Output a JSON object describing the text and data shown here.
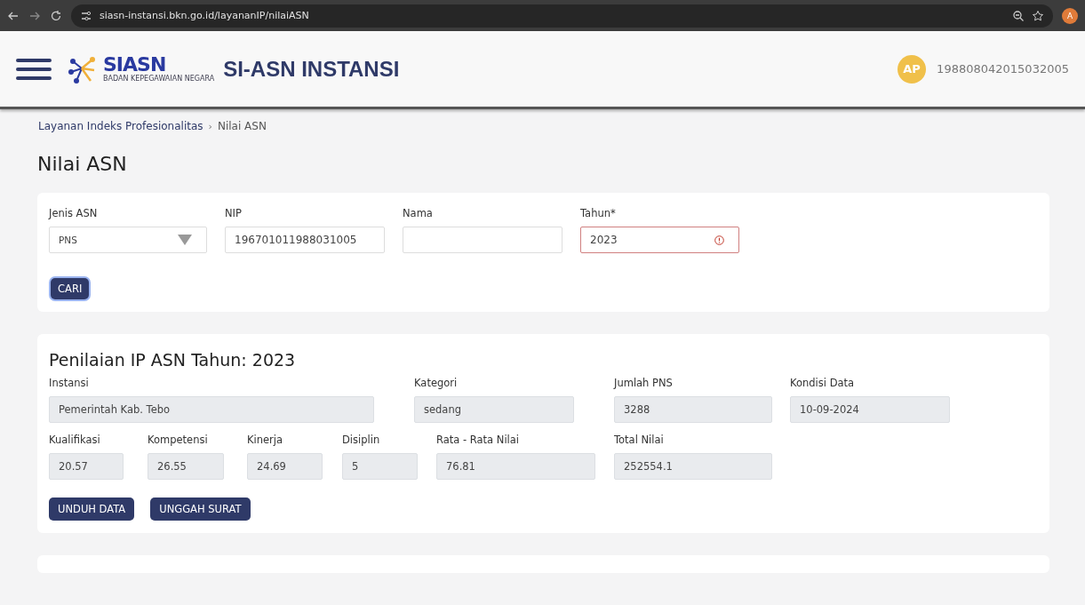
{
  "browser": {
    "url": "siasn-instansi.bkn.go.id/layananIP/nilaiASN",
    "profile_initial": "A"
  },
  "header": {
    "logo_text": "SIASN",
    "logo_subtext": "BADAN KEPEGAWAIAN NEGARA",
    "app_title": "SI-ASN INSTANSI",
    "avatar_initials": "AP",
    "user_id": "198808042015032005"
  },
  "breadcrumb": {
    "items": [
      "Layanan Indeks Profesionalitas",
      "Nilai ASN"
    ],
    "separator": "›"
  },
  "page_title": "Nilai ASN",
  "search_form": {
    "fields": [
      {
        "kind": "select",
        "label": "Jenis ASN",
        "value": "PNS",
        "error": false
      },
      {
        "kind": "text",
        "label": "NIP",
        "value": "196701011988031005",
        "error": false
      },
      {
        "kind": "text",
        "label": "Nama",
        "error": false
      },
      {
        "kind": "text",
        "label": "Tahun*",
        "value": "2023",
        "error": true
      }
    ],
    "button": "CARI"
  },
  "result": {
    "title": "Penilaian IP ASN Tahun: 2023",
    "summary": [
      {
        "label": "Instansi",
        "value": "Pemerintah Kab. Tebo"
      },
      {
        "label": "Kategori",
        "value": "sedang"
      },
      {
        "label": "Jumlah PNS",
        "value": "3288"
      },
      {
        "label": "Kondisi Data",
        "value": "10-09-2024"
      }
    ],
    "scores": [
      {
        "label": "Kualifikasi",
        "value": "20.57"
      },
      {
        "label": "Kompetensi",
        "value": "26.55"
      },
      {
        "label": "Kinerja",
        "value": "24.69"
      },
      {
        "label": "Disiplin",
        "value": "5"
      },
      {
        "label": "Rata - Rata Nilai",
        "value": "76.81"
      },
      {
        "label": "Total Nilai",
        "value": "252554.1"
      }
    ],
    "buttons": [
      "UNDUH DATA",
      "UNGGAH SURAT"
    ]
  }
}
